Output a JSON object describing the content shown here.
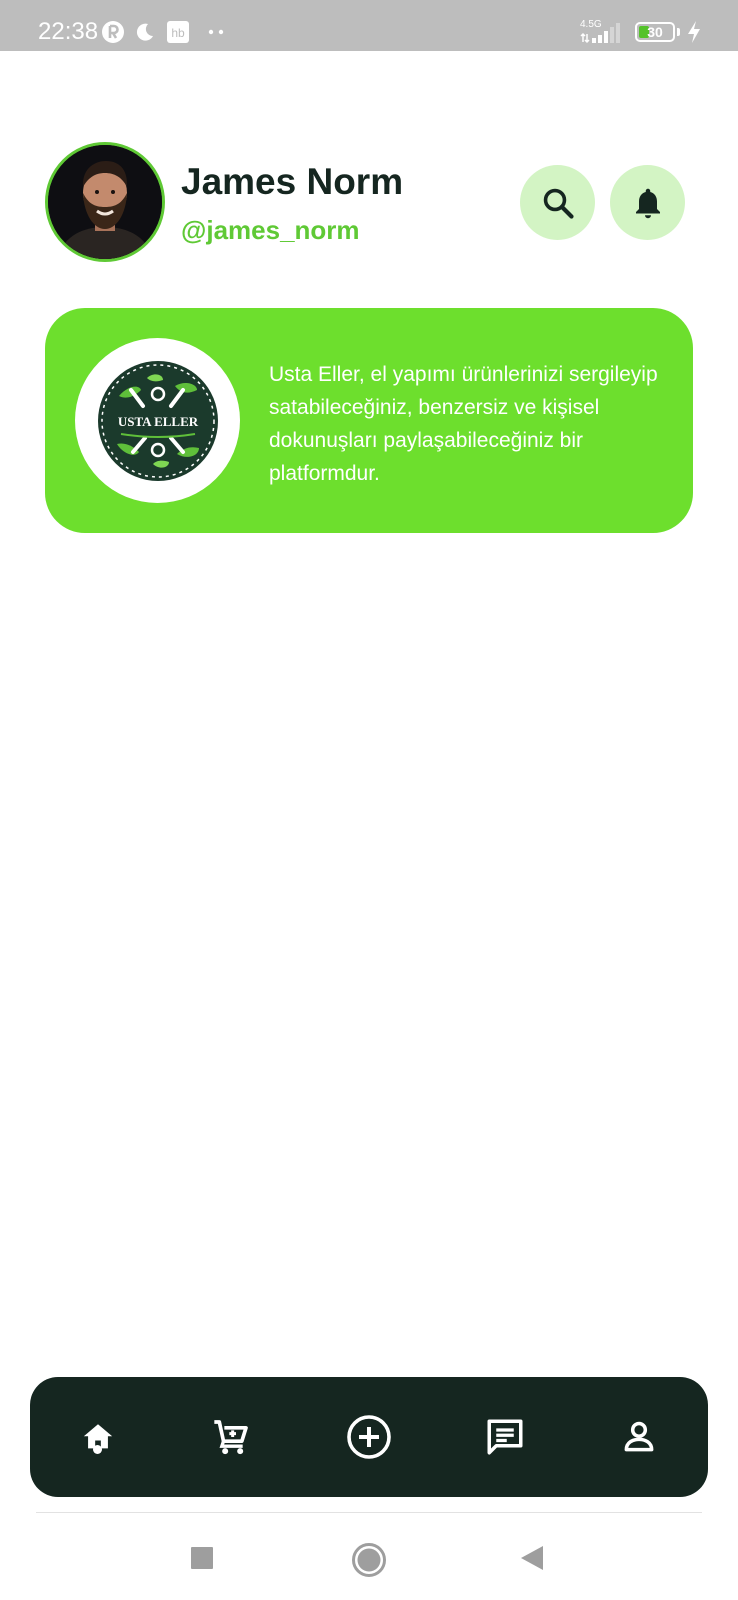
{
  "status_bar": {
    "time": "22:38",
    "network_label": "4.5G",
    "battery_level": "30",
    "battery_percent": 30,
    "icons": [
      "notification-r-icon",
      "moon-icon",
      "hb-app-icon",
      "more-dots-icon",
      "signal-icon",
      "battery-icon",
      "charging-icon"
    ]
  },
  "profile": {
    "name": "James Norm",
    "handle": "@james_norm"
  },
  "header_actions": {
    "search_icon": "search-icon",
    "notifications_icon": "bell-icon"
  },
  "banner": {
    "logo_text": "USTA ELLER",
    "description": "Usta Eller, el yapımı ürünlerinizi sergileyip satabileceğiniz, benzersiz ve kişisel dokunuşları paylaşabileceğiniz bir platformdur."
  },
  "bottom_nav": {
    "items": [
      {
        "icon": "home-icon",
        "active": true
      },
      {
        "icon": "cart-icon",
        "active": false
      },
      {
        "icon": "add-circle-icon",
        "active": false
      },
      {
        "icon": "chat-icon",
        "active": false
      },
      {
        "icon": "profile-icon",
        "active": false
      }
    ]
  },
  "system_nav": {
    "icons": [
      "recents-square-icon",
      "home-circle-icon",
      "back-triangle-icon"
    ]
  },
  "colors": {
    "accent_green": "#6ddf2d",
    "handle_green": "#5fc935",
    "light_green": "#d3f4c4",
    "dark": "#152620",
    "status_bar": "#bdbdbd"
  }
}
